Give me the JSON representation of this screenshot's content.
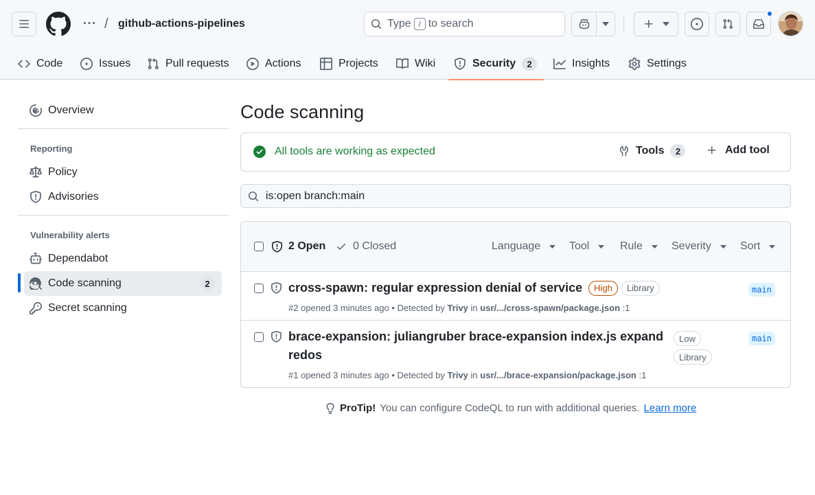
{
  "header": {
    "repo_name": "github-actions-pipelines",
    "breadcrumb_separator": "/",
    "search": {
      "prefix": "Type",
      "key": "/",
      "suffix": "to search"
    },
    "avatar_color": "#b08060"
  },
  "nav": {
    "tabs": [
      {
        "label": "Code",
        "icon": "code-icon"
      },
      {
        "label": "Issues",
        "icon": "issue-opened-icon"
      },
      {
        "label": "Pull requests",
        "icon": "git-pull-request-icon"
      },
      {
        "label": "Actions",
        "icon": "play-icon"
      },
      {
        "label": "Projects",
        "icon": "table-icon"
      },
      {
        "label": "Wiki",
        "icon": "book-icon"
      },
      {
        "label": "Security",
        "icon": "shield-icon",
        "counter": "2",
        "selected": true
      },
      {
        "label": "Insights",
        "icon": "graph-icon"
      },
      {
        "label": "Settings",
        "icon": "gear-icon"
      }
    ],
    "selected_underline_color": "#fd8c73"
  },
  "sidebar": {
    "overview": "Overview",
    "reporting_heading": "Reporting",
    "policy": "Policy",
    "advisories": "Advisories",
    "vuln_heading": "Vulnerability alerts",
    "dependabot": "Dependabot",
    "code_scanning": "Code scanning",
    "code_scanning_count": "2",
    "secret_scanning": "Secret scanning"
  },
  "main": {
    "title": "Code scanning",
    "status_text": "All tools are working as expected",
    "tools_label": "Tools",
    "tools_count": "2",
    "add_tool_label": "Add tool",
    "filter_value": "is:open branch:main",
    "open_label": "2 Open",
    "closed_label": "0 Closed",
    "filters": [
      "Language",
      "Tool",
      "Rule",
      "Severity",
      "Sort"
    ],
    "alerts": [
      {
        "title": "cross-spawn: regular expression denial of service",
        "labels": [
          "High",
          "Library"
        ],
        "number": "#2",
        "opened": "opened 3 minutes ago",
        "detected_prefix": "• Detected by",
        "tool": "Trivy",
        "in": "in",
        "path": "usr/.../cross-spawn/package.json",
        "line": ":1",
        "branch": "main"
      },
      {
        "title_line1": "brace-expansion: juliangruber brace-expansion index.js expand",
        "title_line2": "redos",
        "labels": [
          "Low",
          "Library"
        ],
        "number": "#1",
        "opened": "opened 3 minutes ago",
        "detected_prefix": "• Detected by",
        "tool": "Trivy",
        "in": "in",
        "path": "usr/.../brace-expansion/package.json",
        "line": ":1",
        "branch": "main"
      }
    ],
    "protip_label": "ProTip!",
    "protip_text": "You can configure CodeQL to run with additional queries.",
    "protip_link": "Learn more"
  },
  "colors": {
    "accent": "#0969da",
    "success": "#1a7f37",
    "high_severity": "#bc4c00"
  }
}
